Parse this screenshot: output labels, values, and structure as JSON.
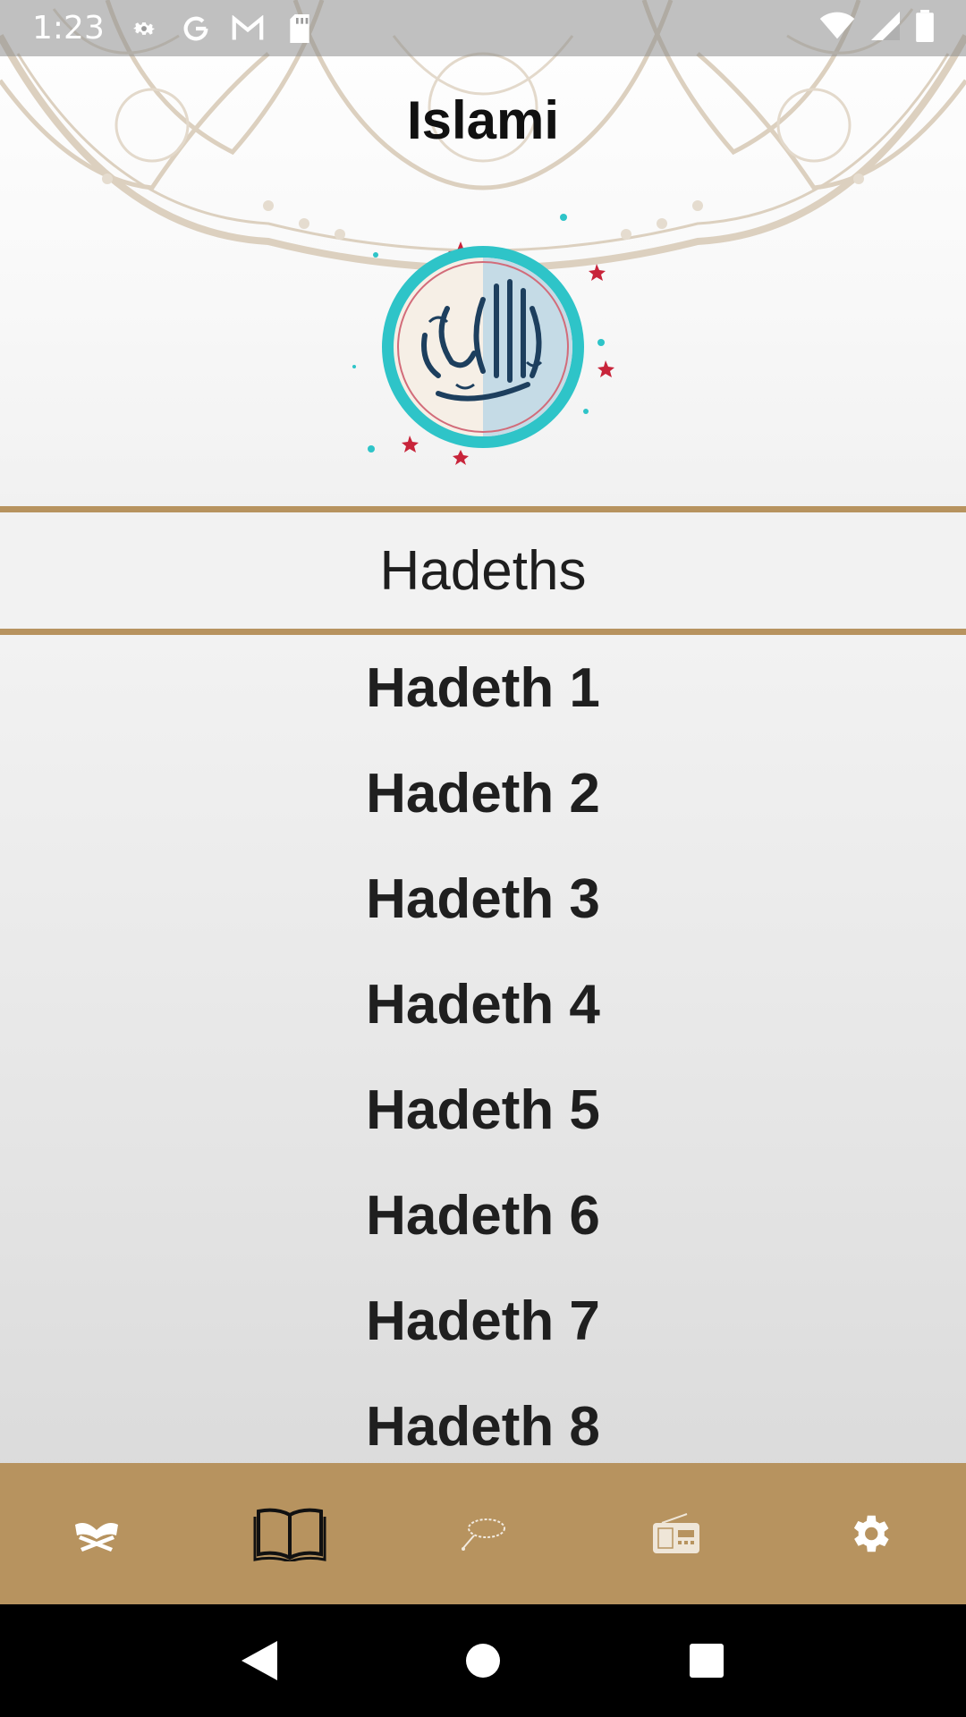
{
  "status_bar": {
    "time": "1:23",
    "icons_left": [
      "gear-icon",
      "google-icon",
      "gmail-icon",
      "sd-card-icon"
    ],
    "icons_right": [
      "wifi-icon",
      "signal-icon",
      "battery-icon"
    ]
  },
  "header": {
    "title": "Islami",
    "emblem": "bismillah-calligraphy-emblem"
  },
  "section": {
    "title": "Hadeths"
  },
  "hadeths": [
    {
      "label": "Hadeth 1"
    },
    {
      "label": "Hadeth 2"
    },
    {
      "label": "Hadeth 3"
    },
    {
      "label": "Hadeth 4"
    },
    {
      "label": "Hadeth 5"
    },
    {
      "label": "Hadeth 6"
    },
    {
      "label": "Hadeth 7"
    },
    {
      "label": "Hadeth 8"
    }
  ],
  "bottom_nav": {
    "items": [
      {
        "icon": "quran-icon",
        "selected": false
      },
      {
        "icon": "book-icon",
        "selected": true
      },
      {
        "icon": "sebha-icon",
        "selected": false
      },
      {
        "icon": "radio-icon",
        "selected": false
      },
      {
        "icon": "settings-icon",
        "selected": false
      }
    ]
  },
  "colors": {
    "accent": "#b7935f",
    "title_text": "#111111",
    "list_text": "#1f1f1f"
  }
}
